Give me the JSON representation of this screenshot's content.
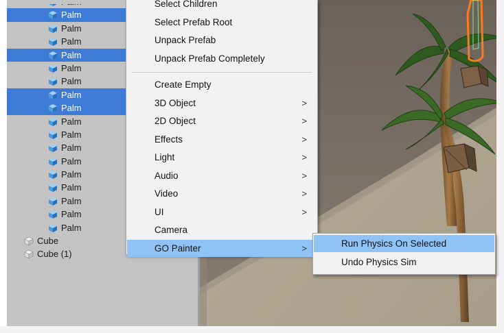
{
  "hierarchy": {
    "rows": [
      {
        "label": "Palm",
        "selected": false,
        "type": "prefab",
        "indent": "child"
      },
      {
        "label": "Palm",
        "selected": true,
        "type": "prefab",
        "indent": "child"
      },
      {
        "label": "Palm",
        "selected": false,
        "type": "prefab",
        "indent": "child"
      },
      {
        "label": "Palm",
        "selected": false,
        "type": "prefab",
        "indent": "child"
      },
      {
        "label": "Palm",
        "selected": true,
        "type": "prefab",
        "indent": "child"
      },
      {
        "label": "Palm",
        "selected": false,
        "type": "prefab",
        "indent": "child"
      },
      {
        "label": "Palm",
        "selected": false,
        "type": "prefab",
        "indent": "child"
      },
      {
        "label": "Palm",
        "selected": true,
        "type": "prefab",
        "indent": "child"
      },
      {
        "label": "Palm",
        "selected": true,
        "type": "prefab",
        "indent": "child"
      },
      {
        "label": "Palm",
        "selected": false,
        "type": "prefab",
        "indent": "child"
      },
      {
        "label": "Palm",
        "selected": false,
        "type": "prefab",
        "indent": "child"
      },
      {
        "label": "Palm",
        "selected": false,
        "type": "prefab",
        "indent": "child"
      },
      {
        "label": "Palm",
        "selected": false,
        "type": "prefab",
        "indent": "child"
      },
      {
        "label": "Palm",
        "selected": false,
        "type": "prefab",
        "indent": "child"
      },
      {
        "label": "Palm",
        "selected": false,
        "type": "prefab",
        "indent": "child"
      },
      {
        "label": "Palm",
        "selected": false,
        "type": "prefab",
        "indent": "child"
      },
      {
        "label": "Palm",
        "selected": false,
        "type": "prefab",
        "indent": "child"
      },
      {
        "label": "Palm",
        "selected": false,
        "type": "prefab",
        "indent": "child"
      },
      {
        "label": "Cube",
        "selected": false,
        "type": "object",
        "indent": "root"
      },
      {
        "label": "Cube (1)",
        "selected": false,
        "type": "object",
        "indent": "root"
      }
    ],
    "prefab_icon": "prefab-cube-icon",
    "object_icon": "gameobject-cube-icon",
    "selected_color": "#3d7bd6"
  },
  "context_menu": {
    "items": [
      {
        "label": "Select Children",
        "has_submenu": false,
        "separator_before": false,
        "highlighted": false
      },
      {
        "label": "Select Prefab Root",
        "has_submenu": false,
        "separator_before": false,
        "highlighted": false
      },
      {
        "label": "Unpack Prefab",
        "has_submenu": false,
        "separator_before": false,
        "highlighted": false
      },
      {
        "label": "Unpack Prefab Completely",
        "has_submenu": false,
        "separator_before": false,
        "highlighted": false
      },
      {
        "label": "Create Empty",
        "has_submenu": false,
        "separator_before": true,
        "highlighted": false
      },
      {
        "label": "3D Object",
        "has_submenu": true,
        "separator_before": false,
        "highlighted": false
      },
      {
        "label": "2D Object",
        "has_submenu": true,
        "separator_before": false,
        "highlighted": false
      },
      {
        "label": "Effects",
        "has_submenu": true,
        "separator_before": false,
        "highlighted": false
      },
      {
        "label": "Light",
        "has_submenu": true,
        "separator_before": false,
        "highlighted": false
      },
      {
        "label": "Audio",
        "has_submenu": true,
        "separator_before": false,
        "highlighted": false
      },
      {
        "label": "Video",
        "has_submenu": true,
        "separator_before": false,
        "highlighted": false
      },
      {
        "label": "UI",
        "has_submenu": true,
        "separator_before": false,
        "highlighted": false
      },
      {
        "label": "Camera",
        "has_submenu": false,
        "separator_before": false,
        "highlighted": false
      },
      {
        "label": "GO Painter",
        "has_submenu": true,
        "separator_before": false,
        "highlighted": true
      }
    ],
    "arrow_glyph": ">",
    "highlight_color": "#8fc3f5"
  },
  "submenu": {
    "items": [
      {
        "label": "Run Physics On Selected",
        "highlighted": true
      },
      {
        "label": "Undo Physics Sim",
        "highlighted": false
      }
    ]
  }
}
